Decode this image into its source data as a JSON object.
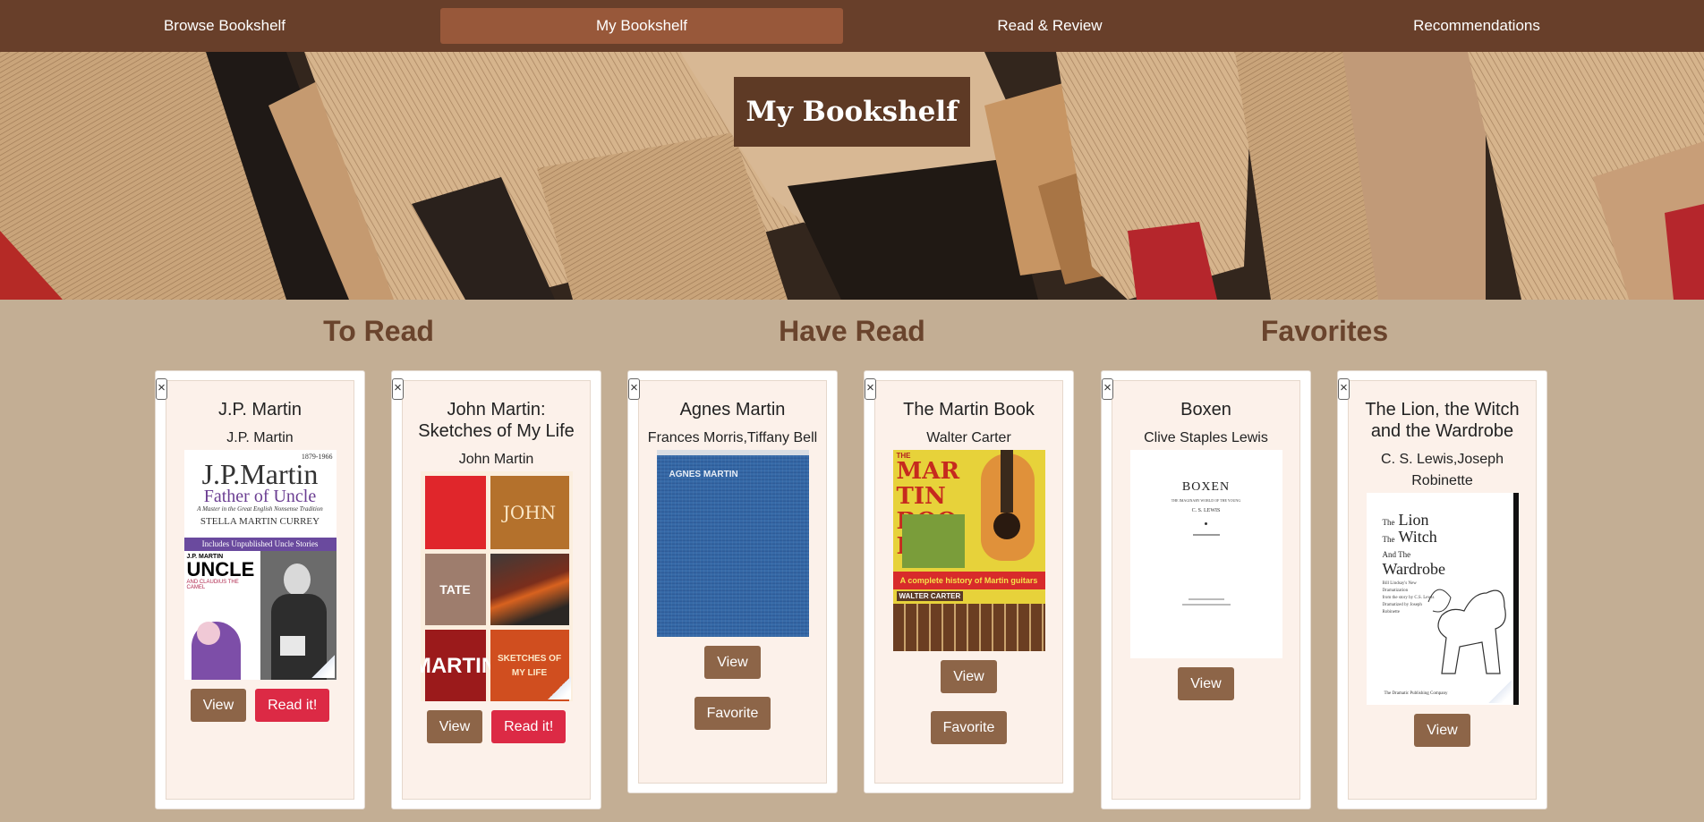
{
  "nav": {
    "items": [
      {
        "label": "Browse Bookshelf"
      },
      {
        "label": "My Bookshelf"
      },
      {
        "label": "Read & Review"
      },
      {
        "label": "Recommendations"
      }
    ],
    "active_index": 1
  },
  "hero": {
    "title": "My Bookshelf"
  },
  "sections": [
    {
      "heading": "To Read"
    },
    {
      "heading": "Have Read"
    },
    {
      "heading": "Favorites"
    }
  ],
  "close_glyph": "×",
  "cards": [
    {
      "title": "J.P. Martin",
      "author": "J.P. Martin",
      "view_label": "View",
      "read_label": "Read it!",
      "cover": {
        "line1": "1879-1966",
        "title": "J.P.Martin",
        "subtitle": "Father of Uncle",
        "tagline": "A Master in the Great English Nonsense Tradition",
        "author": "STELLA MARTIN CURREY",
        "banner": "Includes Unpublished Uncle Stories",
        "uncle": "UNCLE",
        "uncle_sub": "AND CLAUDIUS THE CAMEL",
        "uncle_top": "J.P. MARTIN"
      }
    },
    {
      "title": "John Martin: Sketches of My Life",
      "author": "John Martin",
      "view_label": "View",
      "read_label": "Read it!",
      "cover": {
        "w1": "JOHN",
        "w2": "TATE",
        "w3": "MARTIN",
        "w4": "SKETCHES OF MY LIFE"
      }
    },
    {
      "title": "Agnes Martin",
      "author": "Frances Morris,Tiffany Bell",
      "view_label": "View",
      "fav_label": "Favorite",
      "cover": {
        "label": "AGNES MARTIN"
      }
    },
    {
      "title": "The Martin Book",
      "author": "Walter Carter",
      "view_label": "View",
      "fav_label": "Favorite",
      "cover": {
        "title": "MARTIN BOOK",
        "the": "THE",
        "sub": "A complete history of Martin guitars",
        "author": "WALTER CARTER"
      }
    },
    {
      "title": "Boxen",
      "author": "Clive Staples Lewis",
      "view_label": "View",
      "cover": {
        "title": "BOXEN",
        "sub": "THE IMAGINARY WORLD OF THE YOUNG",
        "author": "C. S. LEWIS"
      }
    },
    {
      "title": "The Lion, the Witch and the Wardrobe",
      "author": "C. S. Lewis,Joseph Robinette",
      "view_label": "View",
      "cover": {
        "l1": "The",
        "l2": "Lion",
        "l3": "The",
        "l4": "Witch",
        "l5": "And The",
        "l6": "Wardrobe",
        "small": "Bill Lindsay's New Dramatization",
        "small2": "from the story by C.S. Lewis",
        "small3": "Dramatized by Joseph Robinette",
        "pub": "The Dramatic Publishing Company"
      }
    }
  ],
  "colors": {
    "nav_bg": "#683f2a",
    "nav_active": "#98583a",
    "page_bg": "#c3ae94",
    "heading": "#6a442d",
    "btn_brown": "#8d6548",
    "btn_red": "#dc2a45"
  }
}
